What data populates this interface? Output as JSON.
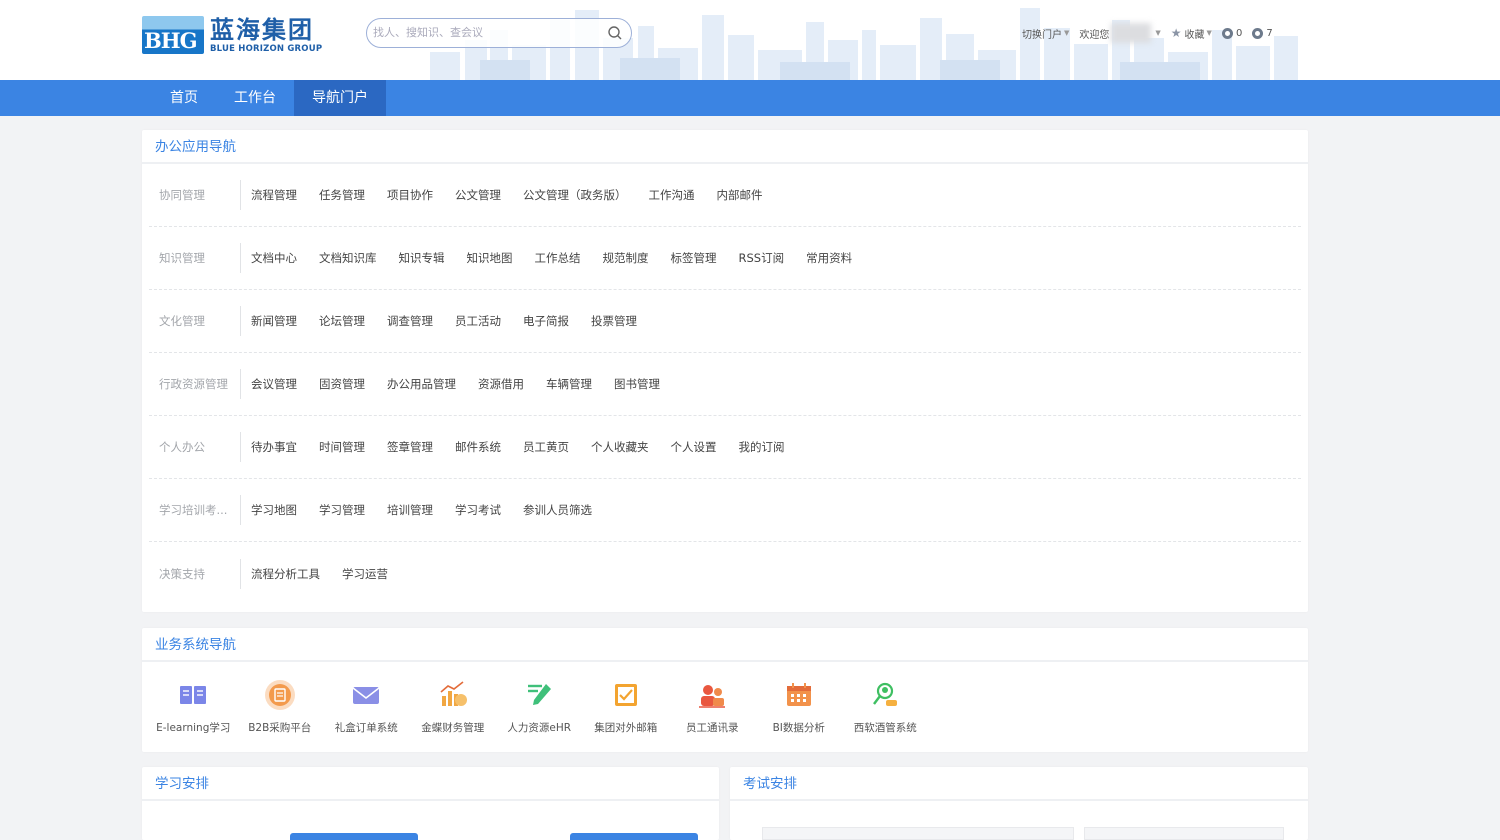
{
  "logo": {
    "mark": "BHG",
    "cn": "蓝海集团",
    "en": "BLUE HORIZON GROUP"
  },
  "search": {
    "placeholder": "找人、搜知识、查会议"
  },
  "toolbar": {
    "switch_portal": "切换门户",
    "welcome": "欢迎您",
    "favorites": "收藏",
    "count_a": "0",
    "count_b": "7"
  },
  "nav": {
    "items": [
      "首页",
      "工作台",
      "导航门户"
    ],
    "active_index": 2
  },
  "office": {
    "title": "办公应用导航",
    "rows": [
      {
        "category": "协同管理",
        "links": [
          "流程管理",
          "任务管理",
          "项目协作",
          "公文管理",
          "公文管理（政务版）",
          "工作沟通",
          "内部邮件"
        ]
      },
      {
        "category": "知识管理",
        "links": [
          "文档中心",
          "文档知识库",
          "知识专辑",
          "知识地图",
          "工作总结",
          "规范制度",
          "标签管理",
          "RSS订阅",
          "常用资料"
        ]
      },
      {
        "category": "文化管理",
        "links": [
          "新闻管理",
          "论坛管理",
          "调查管理",
          "员工活动",
          "电子简报",
          "投票管理"
        ]
      },
      {
        "category": "行政资源管理",
        "links": [
          "会议管理",
          "固资管理",
          "办公用品管理",
          "资源借用",
          "车辆管理",
          "图书管理"
        ]
      },
      {
        "category": "个人办公",
        "links": [
          "待办事宜",
          "时间管理",
          "签章管理",
          "邮件系统",
          "员工黄页",
          "个人收藏夹",
          "个人设置",
          "我的订阅"
        ]
      },
      {
        "category": "学习培训考...",
        "links": [
          "学习地图",
          "学习管理",
          "培训管理",
          "学习考试",
          "参训人员筛选"
        ]
      },
      {
        "category": "决策支持",
        "links": [
          "流程分析工具",
          "学习运营"
        ]
      }
    ]
  },
  "business": {
    "title": "业务系统导航",
    "apps": [
      {
        "label": "E-learning学习",
        "icon": "book-icon",
        "color": "#7b86e8"
      },
      {
        "label": "B2B采购平台",
        "icon": "procurement-icon",
        "color": "#f39a4c"
      },
      {
        "label": "礼盒订单系统",
        "icon": "envelope-icon",
        "color": "#8a8fe6"
      },
      {
        "label": "金蝶财务管理",
        "icon": "finance-chart-icon",
        "color": "#f1a742"
      },
      {
        "label": "人力资源eHR",
        "icon": "pen-icon",
        "color": "#3fc07a"
      },
      {
        "label": "集团对外邮箱",
        "icon": "checkbox-icon",
        "color": "#f3a430"
      },
      {
        "label": "员工通讯录",
        "icon": "contacts-icon",
        "color": "#e9573f"
      },
      {
        "label": "BI数据分析",
        "icon": "calendar-icon",
        "color": "#f2924b"
      },
      {
        "label": "西软酒管系统",
        "icon": "user-search-icon",
        "color": "#3fbf62"
      }
    ]
  },
  "learning": {
    "title": "学习安排"
  },
  "exam": {
    "title": "考试安排"
  },
  "colors": {
    "brand": "#3b84e3",
    "nav_active": "#2b68c2",
    "logo": "#1f5fa8"
  }
}
